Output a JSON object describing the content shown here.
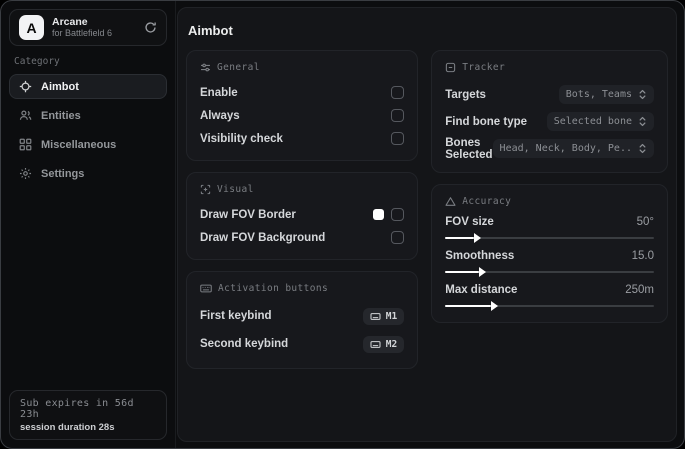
{
  "app": {
    "name": "Arcane",
    "subtitle": "for Battlefield 6",
    "logo_letter": "A"
  },
  "sidebar": {
    "category_label": "Category",
    "items": [
      {
        "label": "Aimbot",
        "icon": "crosshair-icon",
        "active": true
      },
      {
        "label": "Entities",
        "icon": "entities-icon",
        "active": false
      },
      {
        "label": "Miscellaneous",
        "icon": "grid-icon",
        "active": false
      },
      {
        "label": "Settings",
        "icon": "gear-icon",
        "active": false
      }
    ],
    "subscription": {
      "expires": "Sub expires in 56d 23h",
      "session": "session duration 28s"
    }
  },
  "main": {
    "title": "Aimbot",
    "general": {
      "title": "General",
      "icon": "sliders-icon",
      "rows": [
        {
          "label": "Enable",
          "checked": false
        },
        {
          "label": "Always",
          "checked": false
        },
        {
          "label": "Visibility check",
          "checked": false
        }
      ]
    },
    "visual": {
      "title": "Visual",
      "icon": "focus-icon",
      "rows": [
        {
          "label": "Draw FOV Border",
          "swatch": "#ffffff",
          "checked": false
        },
        {
          "label": "Draw FOV Background",
          "checked": false
        }
      ]
    },
    "activation": {
      "title": "Activation buttons",
      "icon": "keyboard-icon",
      "rows": [
        {
          "label": "First keybind",
          "key": "M1"
        },
        {
          "label": "Second keybind",
          "key": "M2"
        }
      ]
    },
    "tracker": {
      "title": "Tracker",
      "icon": "scan-icon",
      "rows": [
        {
          "label": "Targets",
          "value": "Bots, Teams"
        },
        {
          "label": "Find bone type",
          "value": "Selected bone"
        },
        {
          "label": "Bones Selected",
          "value": "Head, Neck, Body, Pe.."
        }
      ]
    },
    "accuracy": {
      "title": "Accuracy",
      "icon": "triangle-icon",
      "sliders": [
        {
          "label": "FOV size",
          "value": "50°",
          "percent": 14
        },
        {
          "label": "Smoothness",
          "value": "15.0",
          "percent": 16
        },
        {
          "label": "Max distance",
          "value": "250m",
          "percent": 22
        }
      ]
    }
  },
  "colors": {
    "fov_border_swatch": "#ffffff",
    "slider_fill": "#ffffff"
  }
}
